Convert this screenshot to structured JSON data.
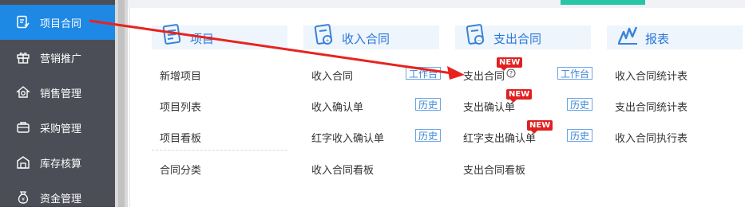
{
  "sidebar": {
    "items": [
      {
        "label": "项目合同",
        "icon": "contract-icon",
        "active": true
      },
      {
        "label": "营销推广",
        "icon": "gift-icon",
        "active": false
      },
      {
        "label": "销售管理",
        "icon": "sales-icon",
        "active": false
      },
      {
        "label": "采购管理",
        "icon": "briefcase-icon",
        "active": false
      },
      {
        "label": "库存核算",
        "icon": "warehouse-icon",
        "active": false
      },
      {
        "label": "资金管理",
        "icon": "money-bag-icon",
        "active": false
      }
    ]
  },
  "columns": [
    {
      "header": "项目",
      "items": [
        {
          "label": "新增项目"
        },
        {
          "label": "项目列表"
        },
        {
          "label": "项目看板"
        },
        {
          "label": "合同分类"
        }
      ]
    },
    {
      "header": "收入合同",
      "items": [
        {
          "label": "收入合同",
          "tag": "工作台"
        },
        {
          "label": "收入确认单",
          "tag": "历史"
        },
        {
          "label": "红字收入确认单",
          "tag": "历史"
        },
        {
          "label": "收入合同看板"
        }
      ]
    },
    {
      "header": "支出合同",
      "items": [
        {
          "label": "支出合同",
          "tag": "工作台",
          "badge": "NEW",
          "help_icon": "question-circle-icon"
        },
        {
          "label": "支出确认单",
          "tag": "历史",
          "badge": "NEW"
        },
        {
          "label": "红字支出确认单",
          "tag": "历史",
          "badge": "NEW"
        },
        {
          "label": "支出合同看板"
        }
      ]
    },
    {
      "header": "报表",
      "items": [
        {
          "label": "收入合同统计表"
        },
        {
          "label": "支出合同统计表"
        },
        {
          "label": "收入合同执行表"
        }
      ]
    }
  ],
  "colors": {
    "sidebar_bg": "#4c4e57",
    "sidebar_active": "#1e88e5",
    "header_bg": "#eef5fd",
    "header_text": "#2a78d6",
    "tag_border": "#6aa6e6",
    "badge_red": "#e02020",
    "annotation_arrow": "#e8231f",
    "top_accent": "#26c6a6"
  }
}
